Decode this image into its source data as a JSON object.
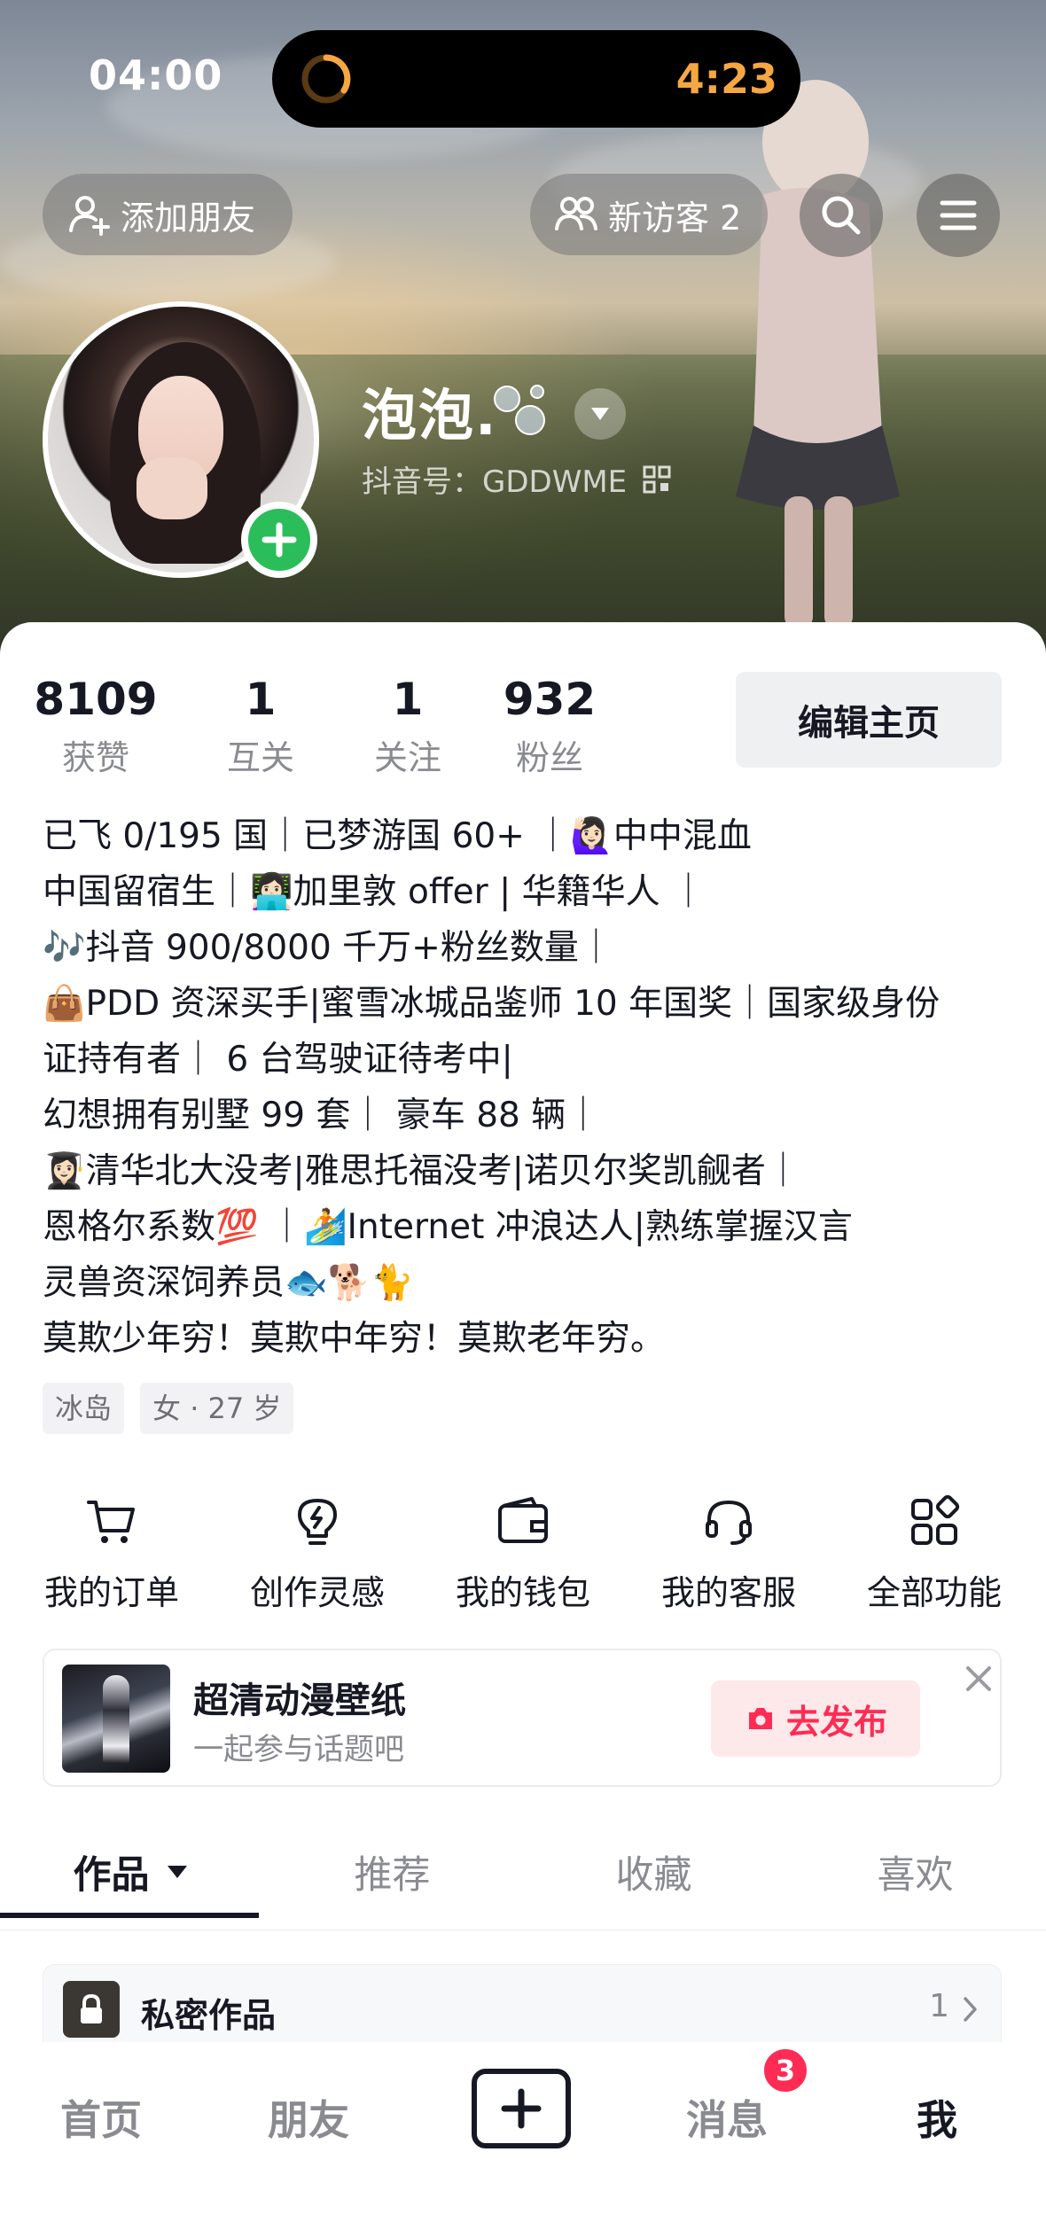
{
  "status_bar": {
    "time": "04:00",
    "island_timer": "4:23"
  },
  "header": {
    "add_friend_label": "添加朋友",
    "new_visitors_label": "新访客 2",
    "icons": [
      "add-friend-icon",
      "visitors-icon",
      "search-icon",
      "menu-icon"
    ]
  },
  "profile": {
    "nickname": "泡泡.",
    "douyin_id": "抖音号：GDDWME",
    "stats": [
      {
        "value": "8109",
        "label": "获赞"
      },
      {
        "value": "1",
        "label": "互关"
      },
      {
        "value": "1",
        "label": "关注"
      },
      {
        "value": "932",
        "label": "粉丝"
      }
    ],
    "edit_button": "编辑主页",
    "bio": [
      "已飞 0/195 国｜已梦游国 60+ ｜🙋🏻‍♀️中中混血",
      "中国留宿生｜👩🏻‍💻加里敦 offer | 华籍华人 ｜",
      "🎶抖音 900/8000 千万+粉丝数量｜",
      "👜PDD 资深买手|蜜雪冰城品鉴师 10 年国奖｜国家级身份",
      "证持有者｜ 6 台驾驶证待考中|",
      "幻想拥有别墅 99 套｜ 豪车 88 辆｜",
      "👩🏻‍🎓清华北大没考|雅思托福没考|诺贝尔奖凯觎者｜",
      "恩格尔系数💯 ｜🏄Internet 冲浪达人|熟练掌握汉言",
      "灵兽资深饲养员🐟🐕🐈",
      "莫欺少年穷！莫欺中年穷！莫欺老年穷。"
    ],
    "tags": [
      "冰岛",
      "女 · 27 岁"
    ]
  },
  "features": [
    {
      "label": "我的订单",
      "icon": "cart-icon"
    },
    {
      "label": "创作灵感",
      "icon": "lightbulb-icon"
    },
    {
      "label": "我的钱包",
      "icon": "wallet-icon"
    },
    {
      "label": "我的客服",
      "icon": "headset-icon"
    },
    {
      "label": "全部功能",
      "icon": "grid-icon"
    }
  ],
  "promo": {
    "title": "超清动漫壁纸",
    "subtitle": "一起参与话题吧",
    "button": "去发布"
  },
  "tabs": [
    {
      "label": "作品",
      "active": true
    },
    {
      "label": "推荐",
      "active": false
    },
    {
      "label": "收藏",
      "active": false
    },
    {
      "label": "喜欢",
      "active": false
    }
  ],
  "private_works": {
    "label": "私密作品",
    "count": "1"
  },
  "bottom_nav": {
    "home": "首页",
    "friends": "朋友",
    "messages": "消息",
    "messages_badge": "3",
    "me": "我"
  },
  "colors": {
    "accent_red": "#fe2c55",
    "add_badge_green": "#2bbd5a",
    "timer_orange": "#f5a742"
  }
}
